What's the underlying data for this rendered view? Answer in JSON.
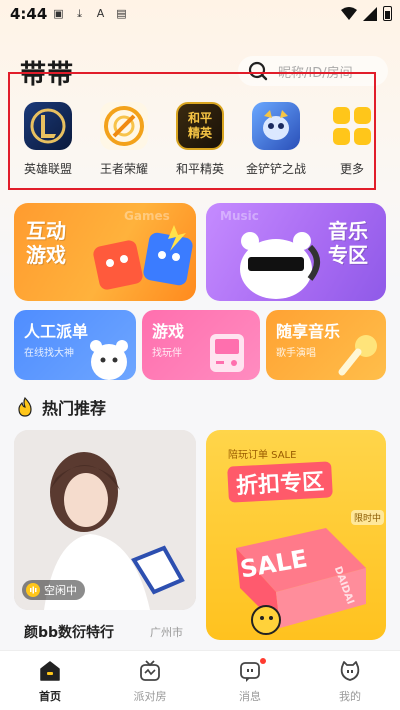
{
  "status_bar": {
    "time": "4:44"
  },
  "header": {
    "brand": "带带",
    "search_placeholder": "昵称/ID/房间"
  },
  "games": [
    {
      "label": "英雄联盟",
      "icon": "league-of-legends-icon"
    },
    {
      "label": "王者荣耀",
      "icon": "honor-of-kings-icon"
    },
    {
      "label": "和平精英",
      "icon": "peace-elite-icon",
      "tile_text": [
        "和平",
        "精英"
      ]
    },
    {
      "label": "金铲铲之战",
      "icon": "golden-spatula-icon"
    },
    {
      "label": "更多",
      "icon": "more-grid-icon"
    }
  ],
  "banners": {
    "interactive_games": {
      "title_line1": "互动",
      "title_line2": "游戏",
      "bg_text": "Games"
    },
    "music_zone": {
      "title_line1": "音乐",
      "title_line2": "专区",
      "bg_text": "Music"
    }
  },
  "small_cards": [
    {
      "title": "人工派单",
      "subtitle": "在线找大神"
    },
    {
      "title": "游戏",
      "subtitle": "找玩伴"
    },
    {
      "title": "随享音乐",
      "subtitle": "歌手演唱"
    }
  ],
  "section": {
    "title": "热门推荐"
  },
  "feed": {
    "room": {
      "status": "空闲中",
      "name": "颜bb数衍特行",
      "city": "广州市"
    },
    "promo": {
      "tag": "陪玩订单 SALE",
      "title": "折扣专区",
      "sale_text": "SALE",
      "brand_text": "DAIDAI",
      "badge": "限时中"
    }
  },
  "bottom_nav": [
    {
      "label": "首页",
      "icon": "home-icon",
      "active": true
    },
    {
      "label": "派对房",
      "icon": "party-tv-icon",
      "active": false
    },
    {
      "label": "消息",
      "icon": "message-icon",
      "active": false
    },
    {
      "label": "我的",
      "icon": "profile-face-icon",
      "active": false
    }
  ],
  "colors": {
    "accent": "#ffc61a",
    "highlight_box": "#e11d2a"
  }
}
